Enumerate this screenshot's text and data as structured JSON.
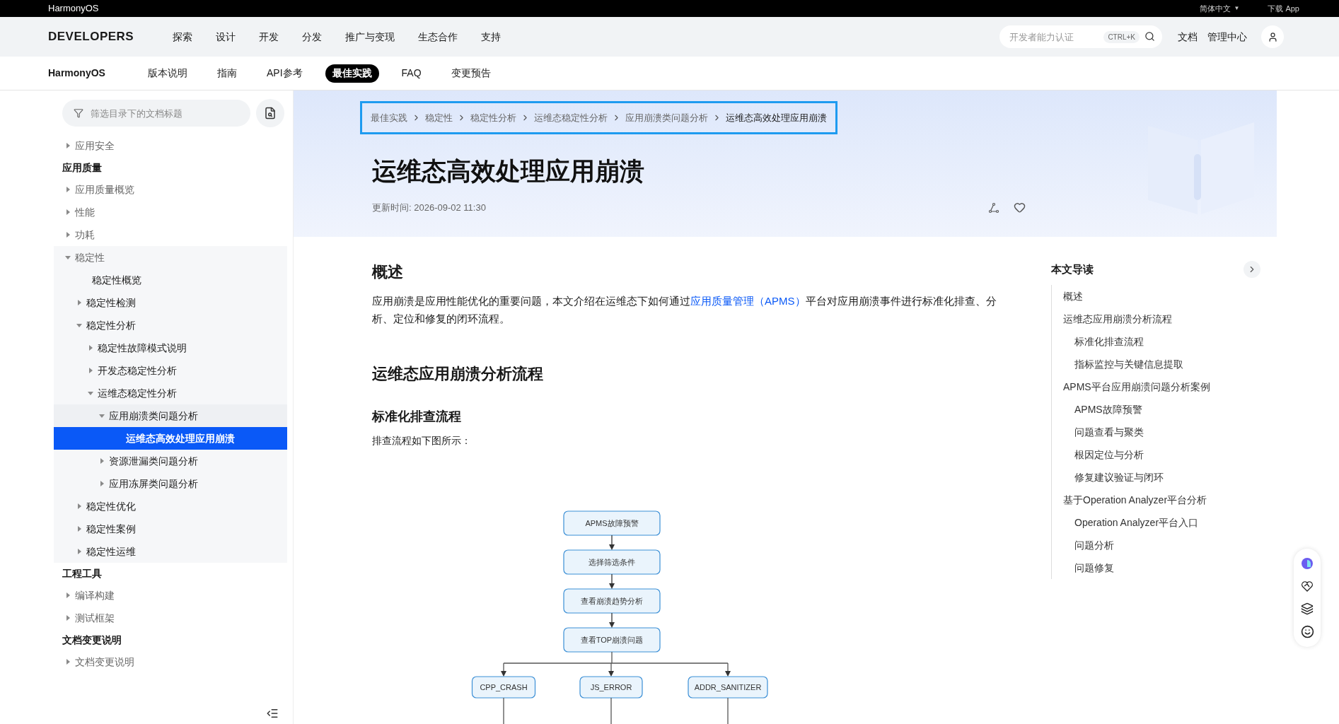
{
  "top_bar": {
    "brand": "HarmonyOS",
    "language": "简体中文",
    "language_caret": "▼",
    "download": "下载 App"
  },
  "nav": {
    "logo": "DEVELOPERS",
    "items": [
      "探索",
      "设计",
      "开发",
      "分发",
      "推广与变现",
      "生态合作",
      "支持"
    ],
    "search": {
      "placeholder": "开发者能力认证",
      "shortcut": "CTRL+K"
    },
    "links": [
      "文档",
      "管理中心"
    ]
  },
  "sub_nav": {
    "brand": "HarmonyOS",
    "tabs": [
      {
        "label": "版本说明",
        "selected": false
      },
      {
        "label": "指南",
        "selected": false
      },
      {
        "label": "API参考",
        "selected": false
      },
      {
        "label": "最佳实践",
        "selected": true
      },
      {
        "label": "FAQ",
        "selected": false
      },
      {
        "label": "变更预告",
        "selected": false
      }
    ]
  },
  "sidebar": {
    "filter": {
      "placeholder": "筛选目录下的文档标题"
    },
    "entries": [
      {
        "kind": "branch",
        "label": "应用安全",
        "expanded": false,
        "selected": false
      },
      {
        "kind": "heading",
        "label": "应用质量"
      },
      {
        "kind": "branch",
        "label": "应用质量概览",
        "expanded": false,
        "selected": false
      },
      {
        "kind": "branch",
        "label": "性能",
        "expanded": false,
        "selected": false
      },
      {
        "kind": "branch",
        "label": "功耗",
        "expanded": false,
        "selected": false
      },
      {
        "kind": "branch",
        "label": "稳定性",
        "expanded": true,
        "selected": false,
        "children": [
          {
            "kind": "leaf",
            "label": "稳定性概览",
            "selected": false
          },
          {
            "kind": "branch",
            "label": "稳定性检测",
            "expanded": false,
            "selected": false
          },
          {
            "kind": "branch",
            "label": "稳定性分析",
            "expanded": true,
            "selected": false,
            "children": [
              {
                "kind": "branch",
                "label": "稳定性故障模式说明",
                "expanded": false,
                "selected": false
              },
              {
                "kind": "branch",
                "label": "开发态稳定性分析",
                "expanded": false,
                "selected": false
              },
              {
                "kind": "branch",
                "label": "运维态稳定性分析",
                "expanded": true,
                "selected": false,
                "children": [
                  {
                    "kind": "branch",
                    "label": "应用崩溃类问题分析",
                    "expanded": true,
                    "selected": false,
                    "children": [
                      {
                        "kind": "leaf",
                        "label": "运维态高效处理应用崩溃",
                        "selected": true
                      }
                    ]
                  },
                  {
                    "kind": "branch",
                    "label": "资源泄漏类问题分析",
                    "expanded": false,
                    "selected": false
                  },
                  {
                    "kind": "branch",
                    "label": "应用冻屏类问题分析",
                    "expanded": false,
                    "selected": false
                  }
                ]
              }
            ]
          },
          {
            "kind": "branch",
            "label": "稳定性优化",
            "expanded": false,
            "selected": false
          },
          {
            "kind": "branch",
            "label": "稳定性案例",
            "expanded": false,
            "selected": false
          },
          {
            "kind": "branch",
            "label": "稳定性运维",
            "expanded": false,
            "selected": false
          }
        ]
      },
      {
        "kind": "heading",
        "label": "工程工具"
      },
      {
        "kind": "branch",
        "label": "编译构建",
        "expanded": false,
        "selected": false
      },
      {
        "kind": "branch",
        "label": "测试框架",
        "expanded": false,
        "selected": false
      },
      {
        "kind": "heading",
        "label": "文档变更说明"
      },
      {
        "kind": "branch",
        "label": "文档变更说明",
        "expanded": false,
        "selected": false
      }
    ]
  },
  "breadcrumb": [
    "最佳实践",
    "稳定性",
    "稳定性分析",
    "运维态稳定性分析",
    "应用崩溃类问题分析",
    "运维态高效处理应用崩溃"
  ],
  "article": {
    "title": "运维态高效处理应用崩溃",
    "updated": "更新时间: 2026-09-02 11:30",
    "sections": [
      {
        "kind": "h2",
        "text": "概述"
      },
      {
        "kind": "paragraph",
        "before": "应用崩溃是应用性能优化的重要问题，本文介绍在运维态下如何通过",
        "link": "应用质量管理（APMS）",
        "after": "平台对应用崩溃事件进行标准化排查、分析、定位和修复的闭环流程。"
      },
      {
        "kind": "h2",
        "text": "运维态应用崩溃分析流程"
      },
      {
        "kind": "h3",
        "text": "标准化排查流程"
      },
      {
        "kind": "text",
        "text": "排查流程如下图所示："
      }
    ],
    "flowchart": {
      "steps": [
        "APMS故障预警",
        "选择筛选条件",
        "查看崩溃趋势分析",
        "查看TOP崩溃问题"
      ],
      "branches": [
        "CPP_CRASH",
        "JS_ERROR",
        "ADDR_SANITIZER"
      ]
    }
  },
  "toc": {
    "title": "本文导读",
    "items": [
      {
        "label": "概述"
      },
      {
        "label": "运维态应用崩溃分析流程",
        "children": [
          {
            "label": "标准化排查流程"
          },
          {
            "label": "指标监控与关键信息提取"
          }
        ]
      },
      {
        "label": "APMS平台应用崩溃问题分析案例",
        "children": [
          {
            "label": "APMS故障预警"
          },
          {
            "label": "问题查看与聚类"
          },
          {
            "label": "根因定位与分析"
          },
          {
            "label": "修复建议验证与闭环"
          }
        ]
      },
      {
        "label": "基于Operation Analyzer平台分析",
        "children": [
          {
            "label": "Operation Analyzer平台入口"
          },
          {
            "label": "问题分析"
          },
          {
            "label": "问题修复"
          }
        ]
      }
    ]
  }
}
